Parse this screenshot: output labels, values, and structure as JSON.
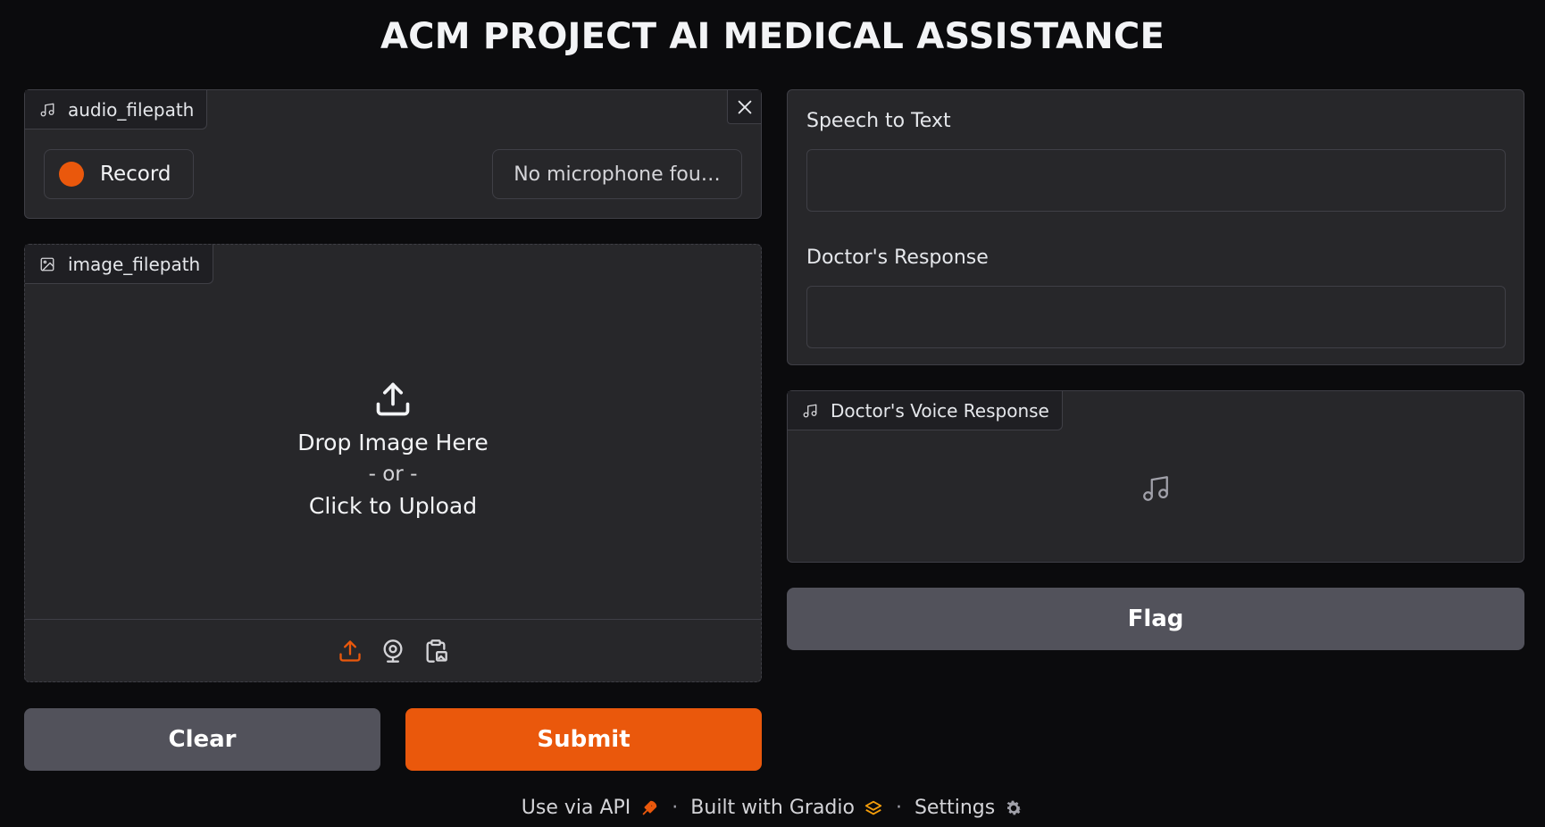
{
  "app": {
    "title": "ACM PROJECT AI MEDICAL ASSISTANCE"
  },
  "audio_input": {
    "label": "audio_filepath",
    "label_icon": "music-note-icon",
    "close_icon": "close-icon",
    "record_label": "Record",
    "microphone_select": "No microphone fou…"
  },
  "image_input": {
    "label": "image_filepath",
    "label_icon": "image-icon",
    "drop_text": "Drop Image Here",
    "or_text": "- or -",
    "click_text": "Click to Upload",
    "sources": [
      "upload-icon",
      "webcam-icon",
      "clipboard-icon"
    ]
  },
  "actions": {
    "clear_label": "Clear",
    "submit_label": "Submit",
    "flag_label": "Flag"
  },
  "outputs": {
    "speech_to_text_label": "Speech to Text",
    "speech_to_text_value": "",
    "doctor_response_label": "Doctor's Response",
    "doctor_response_value": "",
    "voice_response_label": "Doctor's Voice Response"
  },
  "footer": {
    "api_label": "Use via API",
    "built_label": "Built with Gradio",
    "settings_label": "Settings"
  },
  "colors": {
    "accent": "#ea580c",
    "background": "#0b0b0d",
    "panel": "#27272a",
    "secondary_button": "#52525b"
  }
}
